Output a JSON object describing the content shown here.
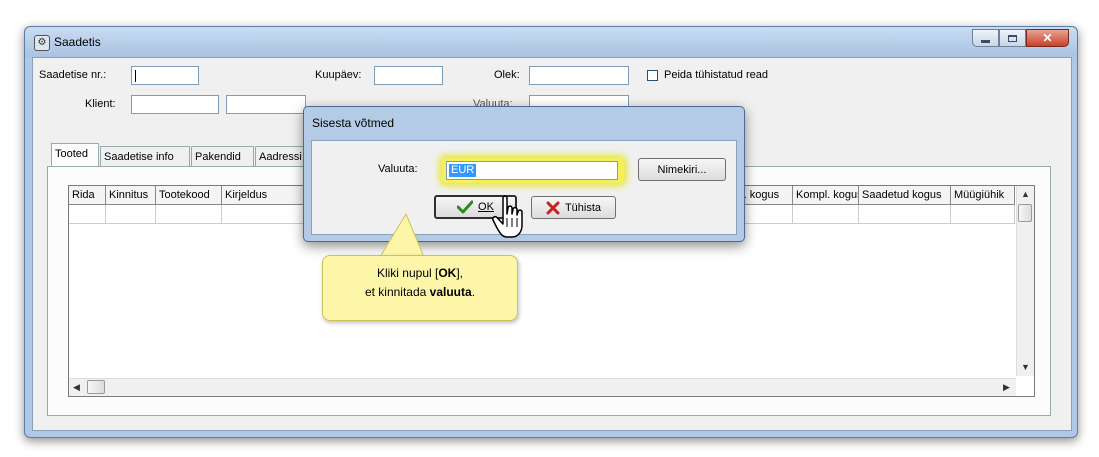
{
  "window": {
    "title": "Saadetis",
    "controls": {
      "close": "✕"
    }
  },
  "form": {
    "saadetise_nr_label": "Saadetise nr.:",
    "kuupaev_label": "Kuupäev:",
    "olek_label": "Olek:",
    "peida_label": "Peida tühistatud read",
    "klient_label": "Klient:",
    "valuuta_label": "Valuuta:"
  },
  "tabs": [
    "Tooted",
    "Saadetise info",
    "Pakendid",
    "Aadressi"
  ],
  "grid": {
    "columns": [
      "Rida",
      "Kinnitus",
      "Tootekood",
      "Kirjeldus",
      "v. kogus",
      "Kompl. kogus",
      "Saadetud kogus",
      "Müügiühik"
    ]
  },
  "dialog": {
    "title": "Sisesta võtmed",
    "valuuta_label": "Valuuta:",
    "valuuta_value": "EUR",
    "nimekiri_label": "Nimekiri...",
    "ok_label": "OK",
    "cancel_label": "Tühista"
  },
  "callout": {
    "line1_prefix": "Kliki nupul [",
    "line1_bold": "OK",
    "line1_suffix": "],",
    "line2_prefix": "et kinnitada ",
    "line2_bold": "valuuta",
    "line2_suffix": "."
  },
  "icons": {
    "app": "gear-icon",
    "ok": "checkmark-icon",
    "cancel": "x-icon",
    "cursor": "hand-pointer-icon"
  },
  "colors": {
    "highlight": "#f5f05a",
    "ok_check": "#2e8b1e",
    "cancel_x": "#c8201a",
    "callout_bg": "#fdf6a8"
  }
}
